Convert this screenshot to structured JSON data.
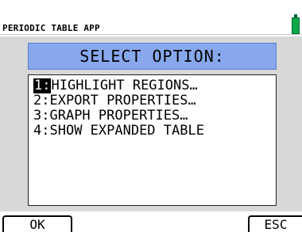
{
  "status_bar": {
    "app_title": "PERIODIC TABLE APP",
    "battery_icon": "battery-full-icon",
    "battery_color": "#0ea84a"
  },
  "dialog": {
    "title": "SELECT OPTION:",
    "title_bg_color": "#88a8ee",
    "options": [
      {
        "number": "1:",
        "label": "HIGHLIGHT REGIONS…",
        "selected": true
      },
      {
        "number": "2:",
        "label": "EXPORT PROPERTIES…",
        "selected": false
      },
      {
        "number": "3:",
        "label": "GRAPH PROPERTIES…",
        "selected": false
      },
      {
        "number": "4:",
        "label": "SHOW EXPANDED TABLE",
        "selected": false
      }
    ]
  },
  "softkeys": {
    "ok_label": "OK",
    "esc_label": "ESC"
  }
}
